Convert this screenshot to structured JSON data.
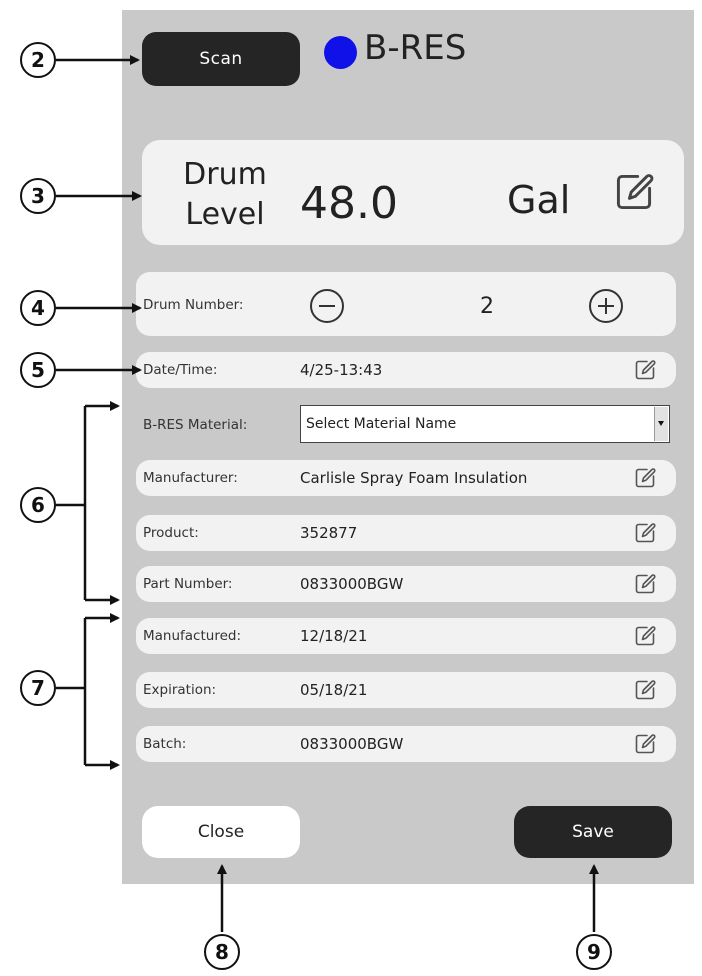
{
  "header": {
    "scan_label": "Scan",
    "title": "B-RES",
    "status_color": "#1010e8"
  },
  "drum_level": {
    "label_line1": "Drum",
    "label_line2": "Level",
    "value": "48.0",
    "unit": "Gal"
  },
  "drum_number": {
    "label": "Drum Number:",
    "value": "2"
  },
  "rows": [
    {
      "label": "Date/Time:",
      "value": "4/25-13:43"
    },
    {
      "label": "B-RES Material:",
      "value": "Select Material Name"
    },
    {
      "label": "Manufacturer:",
      "value": "Carlisle Spray Foam Insulation"
    },
    {
      "label": "Product:",
      "value": "352877"
    },
    {
      "label": "Part Number:",
      "value": "0833000BGW"
    },
    {
      "label": "Manufactured:",
      "value": "12/18/21"
    },
    {
      "label": "Expiration:",
      "value": "05/18/21"
    },
    {
      "label": "Batch:",
      "value": "0833000BGW"
    }
  ],
  "footer": {
    "close_label": "Close",
    "save_label": "Save"
  },
  "callouts": [
    "2",
    "3",
    "4",
    "5",
    "6",
    "7",
    "8",
    "9"
  ]
}
